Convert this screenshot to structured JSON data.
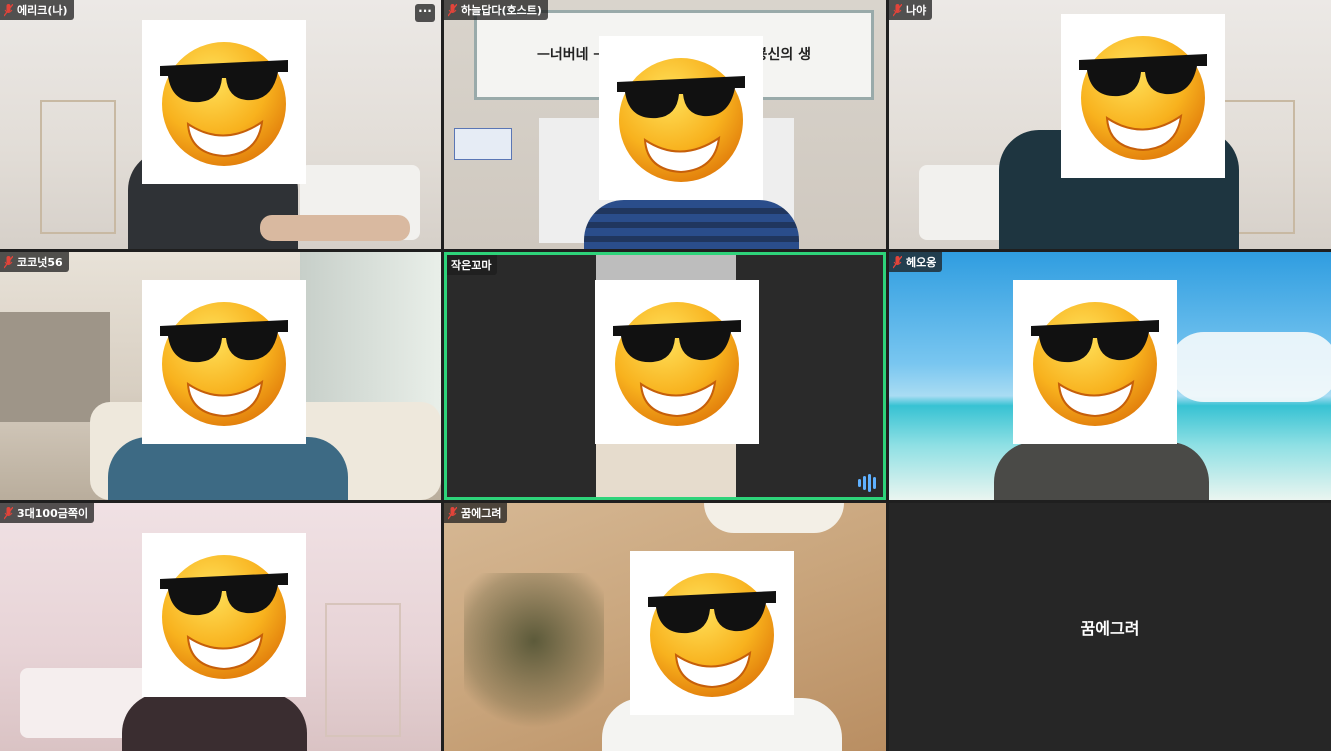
{
  "tiles": [
    {
      "name": "에리크(나)",
      "scene": "room-light",
      "has_more": true,
      "more_label": "···"
    },
    {
      "name": "하늘답다(호스트)",
      "scene": "office-banner",
      "banner_text": "ᅳ너버네 ᅳ라쌈 ᅡ쌈 ᅳᅳ맘 용ᅳ쌈 뵹신의 생"
    },
    {
      "name": "나야",
      "scene": "room-light"
    },
    {
      "name": "코코넛56",
      "scene": "lobby"
    },
    {
      "name": "작은꼬마",
      "scene": "dark-active",
      "active_speaker": true
    },
    {
      "name": "헤오옹",
      "scene": "beach"
    },
    {
      "name": "3대100금쪽이",
      "scene": "room-pink"
    },
    {
      "name": "꿈에그려",
      "scene": "warm-room"
    },
    {
      "name": "",
      "scene": "empty",
      "center_text": "꿈에그려"
    }
  ],
  "colors": {
    "active_border": "#2ed37a",
    "audio_icon": "#5fb1ff",
    "label_bg": "#1e1e1e"
  },
  "icons": {
    "mic": "muted-mic-icon",
    "more": "more-options-icon",
    "audio": "audio-waveform-icon"
  }
}
